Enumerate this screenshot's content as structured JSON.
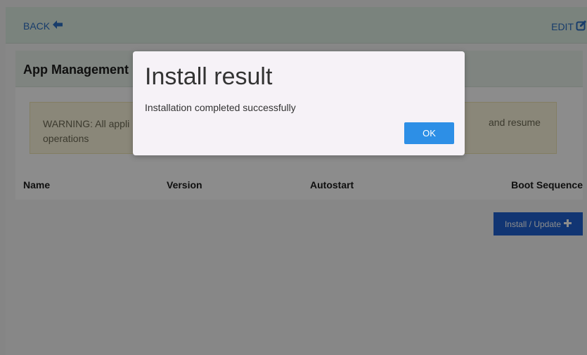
{
  "topbar": {
    "back_label": "BACK",
    "edit_label": "EDIT"
  },
  "panel": {
    "title": "App Management",
    "warning_left_line1": "WARNING: All appli",
    "warning_left_line2": "operations",
    "warning_right": "and resume"
  },
  "table": {
    "columns": [
      "Name",
      "Version",
      "Autostart",
      "Boot Sequence"
    ]
  },
  "install_button": {
    "label": "Install / Update"
  },
  "modal": {
    "title": "Install result",
    "message": "Installation completed successfully",
    "ok_label": "OK"
  },
  "colors": {
    "accent": "#2c6fc4",
    "install_button": "#1f62d1",
    "ok_button": "#2d8fe6",
    "topbar": "#dfeee4",
    "warning_bg": "#fbf6dc"
  },
  "icons": {
    "back": "arrow-left-icon",
    "edit": "edit-square-icon",
    "install": "plus-icon"
  }
}
